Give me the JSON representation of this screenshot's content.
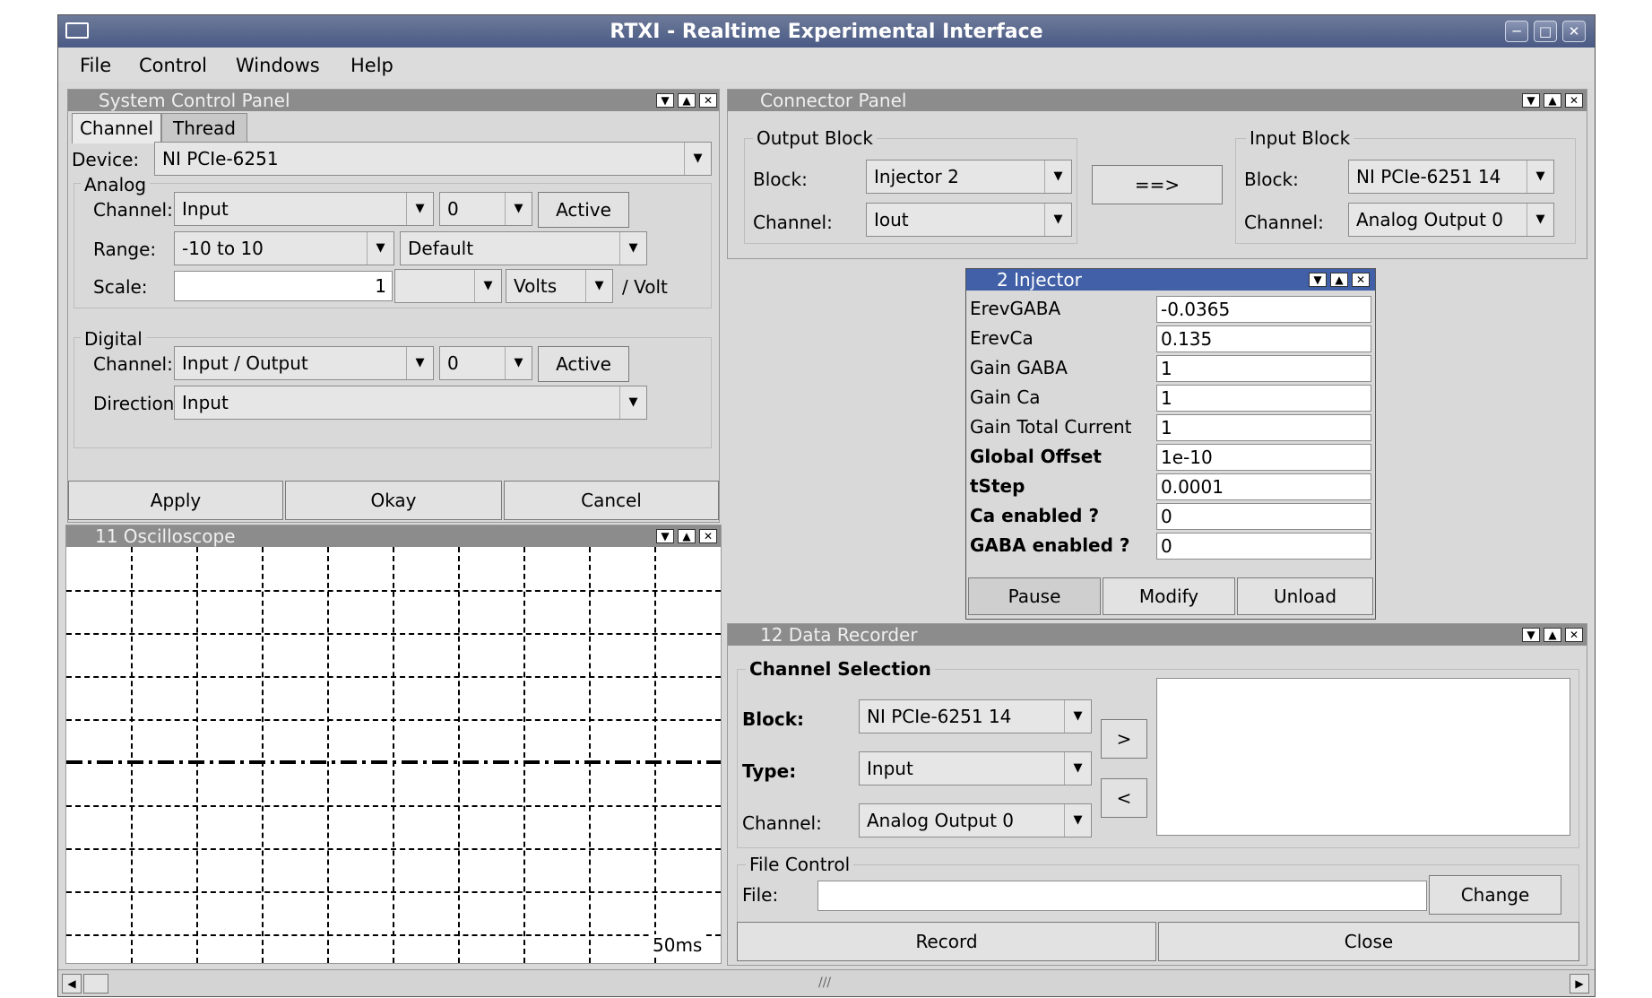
{
  "window": {
    "title": "RTXI - Realtime Experimental Interface"
  },
  "menus": [
    "File",
    "Control",
    "Windows",
    "Help"
  ],
  "system_control": {
    "title": "System Control Panel",
    "tabs": [
      "Channel",
      "Thread"
    ],
    "device_label": "Device:",
    "device_value": "NI PCIe-6251",
    "analog": {
      "label": "Analog",
      "channel_label": "Channel:",
      "channel_type": "Input",
      "channel_index": "0",
      "active_label": "Active",
      "range_label": "Range:",
      "range_value": "-10 to 10",
      "reference_value": "Default",
      "scale_label": "Scale:",
      "scale_value": "1",
      "prefix_value": "",
      "unit_value": "Volts",
      "per_unit": "/ Volt"
    },
    "digital": {
      "label": "Digital",
      "channel_label": "Channel:",
      "channel_type": "Input / Output",
      "channel_index": "0",
      "active_label": "Active",
      "direction_label": "Direction",
      "direction_value": "Input"
    },
    "buttons": {
      "apply": "Apply",
      "okay": "Okay",
      "cancel": "Cancel"
    }
  },
  "oscilloscope": {
    "title": "11 Oscilloscope",
    "timescale": "50ms"
  },
  "connector": {
    "title": "Connector Panel",
    "output_block": {
      "label": "Output Block",
      "block_label": "Block:",
      "block_value": "Injector 2",
      "channel_label": "Channel:",
      "channel_value": "Iout"
    },
    "connect_button": "==>",
    "input_block": {
      "label": "Input Block",
      "block_label": "Block:",
      "block_value": "NI PCIe-6251 14",
      "channel_label": "Channel:",
      "channel_value": "Analog Output 0"
    }
  },
  "injector": {
    "title": "2 Injector",
    "params": [
      {
        "name": "ErevGABA",
        "value": "-0.0365"
      },
      {
        "name": "ErevCa",
        "value": "0.135"
      },
      {
        "name": "Gain GABA",
        "value": "1"
      },
      {
        "name": "Gain Ca",
        "value": "1"
      },
      {
        "name": "Gain Total Current",
        "value": "1"
      },
      {
        "name": "Global Offset",
        "value": "1e-10"
      },
      {
        "name": "tStep",
        "value": "0.0001"
      },
      {
        "name": "Ca enabled ?",
        "value": "0"
      },
      {
        "name": "GABA enabled ?",
        "value": "0"
      }
    ],
    "buttons": {
      "pause": "Pause",
      "modify": "Modify",
      "unload": "Unload"
    }
  },
  "data_recorder": {
    "title": "12 Data Recorder",
    "channel_selection": "Channel Selection",
    "block_label": "Block:",
    "block_value": "NI PCIe-6251 14",
    "type_label": "Type:",
    "type_value": "Input",
    "channel_label": "Channel:",
    "channel_value": "Analog Output 0",
    "add_button": ">",
    "remove_button": "<",
    "file_control": "File Control",
    "file_label": "File:",
    "file_value": "",
    "change_button": "Change",
    "record_button": "Record",
    "close_button": "Close"
  },
  "colors": {
    "active_title": "#4160a8",
    "inactive_title": "#8c8c8c",
    "panel_bg": "#d9d9d9"
  }
}
